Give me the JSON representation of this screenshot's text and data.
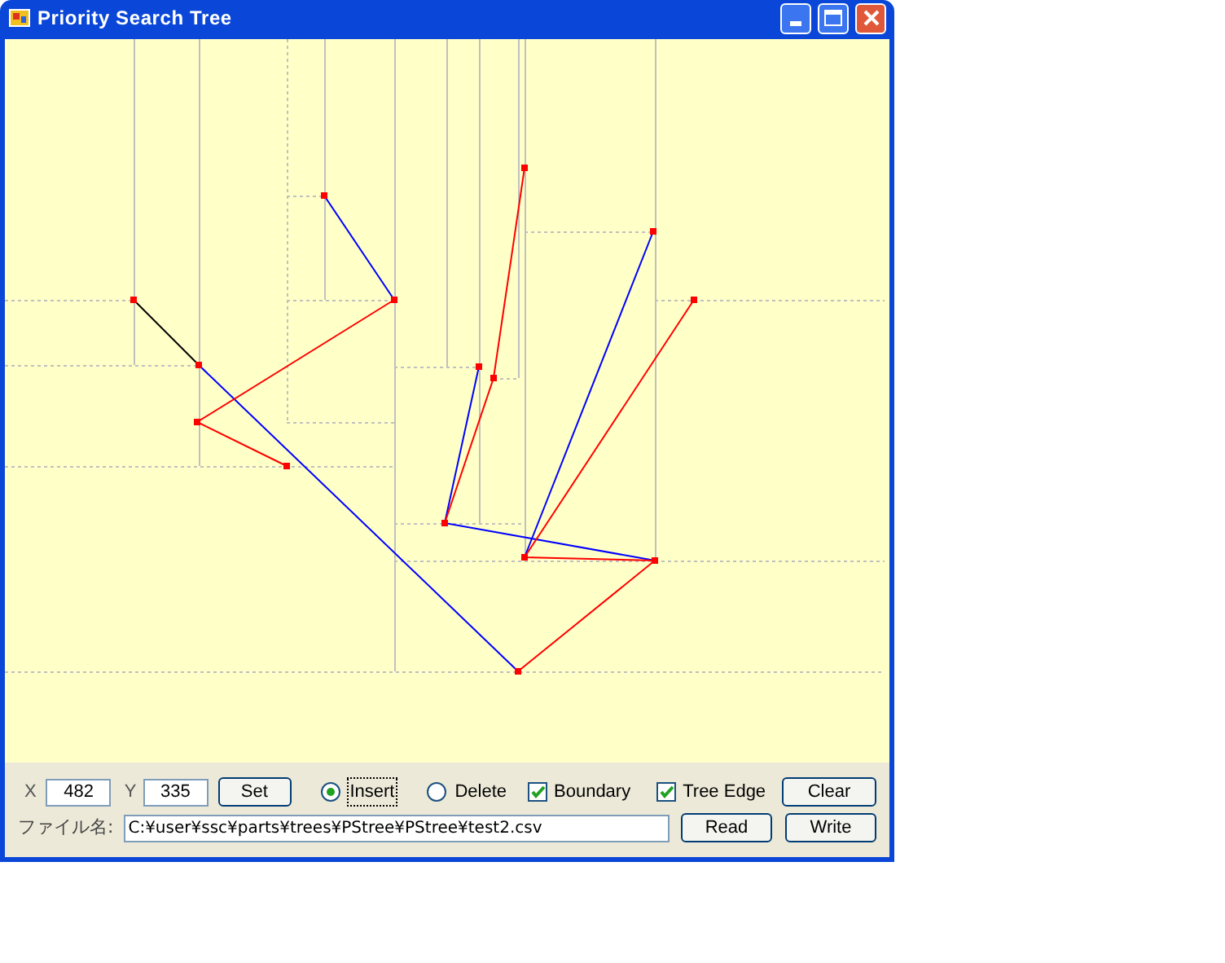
{
  "window": {
    "title": "Priority Search Tree"
  },
  "controls": {
    "x_label": "X",
    "x_value": "482",
    "y_label": "Y",
    "y_value": "335",
    "set_button": "Set",
    "modes": [
      {
        "label": "Insert",
        "selected": true
      },
      {
        "label": "Delete",
        "selected": false
      }
    ],
    "options": [
      {
        "label": "Boundary",
        "checked": true
      },
      {
        "label": "Tree Edge",
        "checked": true
      }
    ],
    "clear_button": "Clear",
    "file_label": "ファイル名:",
    "file_path": "C:¥user¥ssc¥parts¥trees¥PStree¥PStree¥test2.csv",
    "read_button": "Read",
    "write_button": "Write"
  }
}
